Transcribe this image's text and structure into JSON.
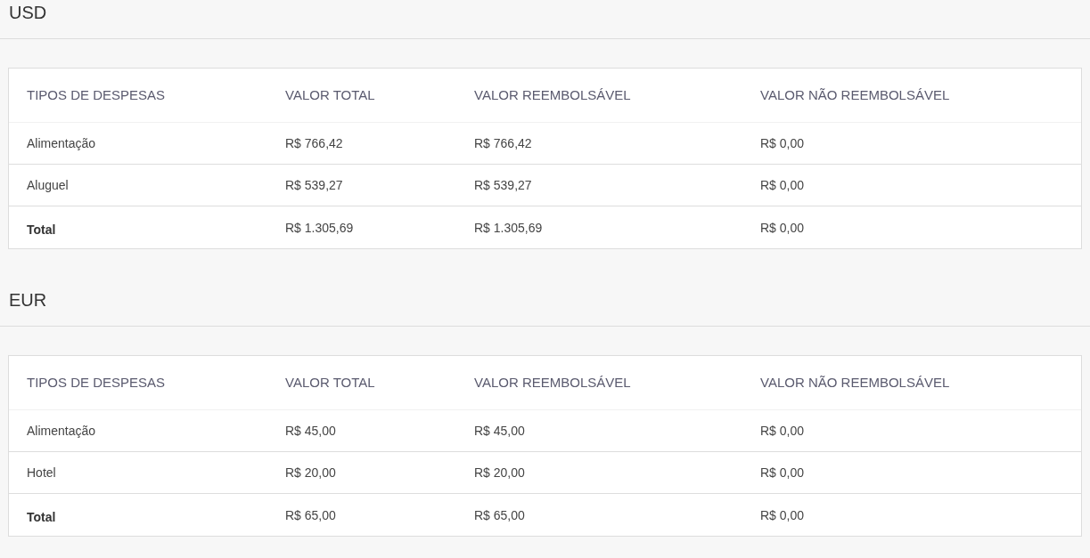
{
  "sections": [
    {
      "currency": "USD",
      "table": {
        "columns": [
          "TIPOS DE DESPESAS",
          "VALOR TOTAL",
          "VALOR REEMBOLSÁVEL",
          "VALOR NÃO REEMBOLSÁVEL"
        ],
        "rows": [
          {
            "kind": "item",
            "cells": [
              "Alimentação",
              "R$ 766,42",
              "R$ 766,42",
              "R$ 0,00"
            ]
          },
          {
            "kind": "item",
            "cells": [
              "Aluguel",
              "R$ 539,27",
              "R$ 539,27",
              "R$ 0,00"
            ]
          },
          {
            "kind": "total",
            "cells": [
              "Total",
              "R$ 1.305,69",
              "R$ 1.305,69",
              "R$ 0,00"
            ]
          }
        ]
      }
    },
    {
      "currency": "EUR",
      "table": {
        "columns": [
          "TIPOS DE DESPESAS",
          "VALOR TOTAL",
          "VALOR REEMBOLSÁVEL",
          "VALOR NÃO REEMBOLSÁVEL"
        ],
        "rows": [
          {
            "kind": "item",
            "cells": [
              "Alimentação",
              "R$ 45,00",
              "R$ 45,00",
              "R$ 0,00"
            ]
          },
          {
            "kind": "item",
            "cells": [
              "Hotel",
              "R$ 20,00",
              "R$ 20,00",
              "R$ 0,00"
            ]
          },
          {
            "kind": "total",
            "cells": [
              "Total",
              "R$ 65,00",
              "R$ 65,00",
              "R$ 0,00"
            ]
          }
        ]
      }
    }
  ]
}
